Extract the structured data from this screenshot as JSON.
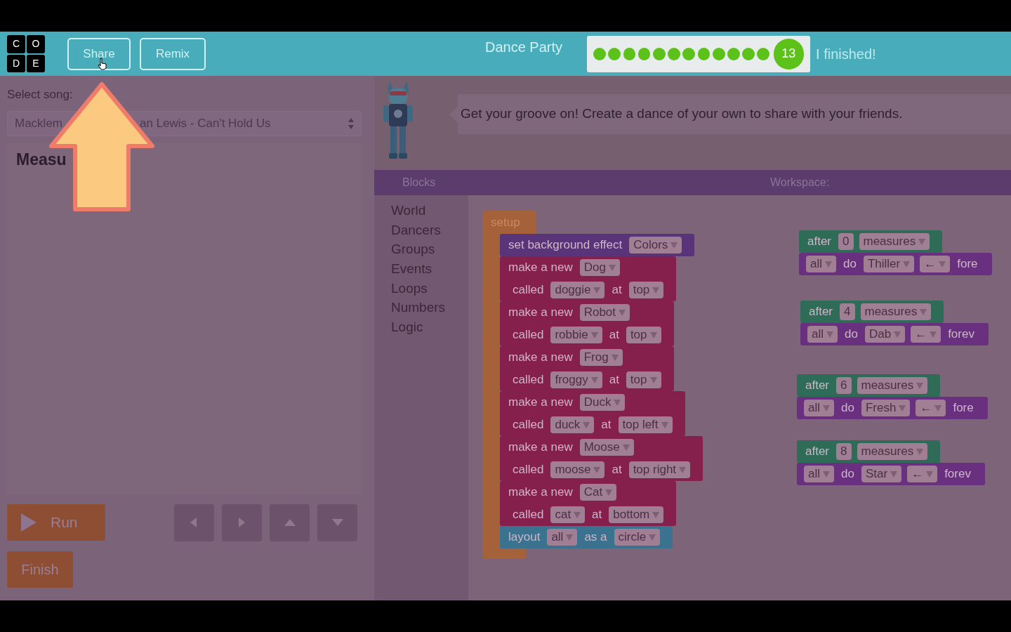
{
  "header": {
    "logo_letters": [
      "C",
      "O",
      "D",
      "E"
    ],
    "buttons": [
      "Share",
      "Remix"
    ],
    "title": "Dance Party",
    "progress": {
      "dots": [
        {
          "completed": true
        },
        {
          "completed": true
        },
        {
          "completed": true
        },
        {
          "completed": true
        },
        {
          "completed": true
        },
        {
          "completed": true
        },
        {
          "completed": true
        },
        {
          "completed": true
        },
        {
          "completed": true
        },
        {
          "completed": true
        },
        {
          "completed": true
        },
        {
          "completed": true
        }
      ],
      "current": "13"
    },
    "finish_link": "I finished!"
  },
  "left_panel": {
    "song_label": "Select song:",
    "song_select_parts": [
      "Macklem",
      "an Lewis - Can't Hold Us"
    ],
    "heading": "Measu",
    "run_button": "Run",
    "arrow_buttons": [
      {
        "kind": "left"
      },
      {
        "kind": "right"
      },
      {
        "kind": "up"
      },
      {
        "kind": "down"
      }
    ],
    "finish_button": "Finish"
  },
  "instructions": "Get your groove on! Create a dance of your own to share with your friends.",
  "blocks_header": "Blocks",
  "workspace_header": "Workspace:",
  "categories": [
    "World",
    "Dancers",
    "Groups",
    "Events",
    "Loops",
    "Numbers",
    "Logic"
  ],
  "workspace": {
    "stacks": [
      {
        "kind": "setup",
        "label": "setup",
        "blocks": [
          {
            "kind": "effect",
            "lines": [
              {
                "parts": [
                  {
                    "kind": "text",
                    "text": "set background effect"
                  },
                  {
                    "kind": "dropdown",
                    "text": "Colors"
                  }
                ]
              }
            ]
          },
          {
            "kind": "sprite",
            "lines": [
              {
                "parts": [
                  {
                    "kind": "text",
                    "text": "make a new"
                  },
                  {
                    "kind": "dropdown",
                    "text": "Dog"
                  }
                ]
              },
              {
                "parts": [
                  {
                    "kind": "text",
                    "text": "called"
                  },
                  {
                    "kind": "dropdown",
                    "text": "doggie"
                  },
                  {
                    "kind": "text",
                    "text": "at"
                  },
                  {
                    "kind": "dropdown",
                    "text": "top"
                  }
                ]
              }
            ]
          },
          {
            "kind": "sprite",
            "lines": [
              {
                "parts": [
                  {
                    "kind": "text",
                    "text": "make a new"
                  },
                  {
                    "kind": "dropdown",
                    "text": "Robot"
                  }
                ]
              },
              {
                "parts": [
                  {
                    "kind": "text",
                    "text": "called"
                  },
                  {
                    "kind": "dropdown",
                    "text": "robbie"
                  },
                  {
                    "kind": "text",
                    "text": "at"
                  },
                  {
                    "kind": "dropdown",
                    "text": "top"
                  }
                ]
              }
            ]
          },
          {
            "kind": "sprite",
            "lines": [
              {
                "parts": [
                  {
                    "kind": "text",
                    "text": "make a new"
                  },
                  {
                    "kind": "dropdown",
                    "text": "Frog"
                  }
                ]
              },
              {
                "parts": [
                  {
                    "kind": "text",
                    "text": "called"
                  },
                  {
                    "kind": "dropdown",
                    "text": "froggy"
                  },
                  {
                    "kind": "text",
                    "text": "at"
                  },
                  {
                    "kind": "dropdown",
                    "text": "top"
                  }
                ]
              }
            ]
          },
          {
            "kind": "sprite",
            "lines": [
              {
                "parts": [
                  {
                    "kind": "text",
                    "text": "make a new"
                  },
                  {
                    "kind": "dropdown",
                    "text": "Duck"
                  }
                ]
              },
              {
                "parts": [
                  {
                    "kind": "text",
                    "text": "called"
                  },
                  {
                    "kind": "dropdown",
                    "text": "duck"
                  },
                  {
                    "kind": "text",
                    "text": "at"
                  },
                  {
                    "kind": "dropdown",
                    "text": "top left"
                  }
                ]
              }
            ]
          },
          {
            "kind": "sprite",
            "lines": [
              {
                "parts": [
                  {
                    "kind": "text",
                    "text": "make a new"
                  },
                  {
                    "kind": "dropdown",
                    "text": "Moose"
                  }
                ]
              },
              {
                "parts": [
                  {
                    "kind": "text",
                    "text": "called"
                  },
                  {
                    "kind": "dropdown",
                    "text": "moose"
                  },
                  {
                    "kind": "text",
                    "text": "at"
                  },
                  {
                    "kind": "dropdown",
                    "text": "top right"
                  }
                ]
              }
            ]
          },
          {
            "kind": "sprite",
            "lines": [
              {
                "parts": [
                  {
                    "kind": "text",
                    "text": "make a new"
                  },
                  {
                    "kind": "dropdown",
                    "text": "Cat"
                  }
                ]
              },
              {
                "parts": [
                  {
                    "kind": "text",
                    "text": "called"
                  },
                  {
                    "kind": "dropdown",
                    "text": "cat"
                  },
                  {
                    "kind": "text",
                    "text": "at"
                  },
                  {
                    "kind": "dropdown",
                    "text": "bottom"
                  }
                ]
              }
            ]
          },
          {
            "kind": "layout",
            "lines": [
              {
                "parts": [
                  {
                    "kind": "text",
                    "text": "layout"
                  },
                  {
                    "kind": "dropdown",
                    "text": "all"
                  },
                  {
                    "kind": "text",
                    "text": "as a"
                  },
                  {
                    "kind": "dropdown",
                    "text": "circle"
                  }
                ]
              }
            ]
          }
        ]
      },
      {
        "kind": "event",
        "blocks": [
          {
            "kind": "event",
            "lines": [
              {
                "parts": [
                  {
                    "kind": "text",
                    "text": "after"
                  },
                  {
                    "kind": "number",
                    "text": "0"
                  },
                  {
                    "kind": "dropdown",
                    "text": "measures"
                  }
                ]
              }
            ]
          },
          {
            "kind": "action",
            "lines": [
              {
                "parts": [
                  {
                    "kind": "dropdown",
                    "text": "all"
                  },
                  {
                    "kind": "text",
                    "text": "do"
                  },
                  {
                    "kind": "dropdown",
                    "text": "Thiller"
                  },
                  {
                    "kind": "dropdown",
                    "text": "←"
                  },
                  {
                    "kind": "text",
                    "text": "fore"
                  }
                ]
              }
            ]
          }
        ]
      },
      {
        "kind": "event",
        "blocks": [
          {
            "kind": "event",
            "lines": [
              {
                "parts": [
                  {
                    "kind": "text",
                    "text": "after"
                  },
                  {
                    "kind": "number",
                    "text": "4"
                  },
                  {
                    "kind": "dropdown",
                    "text": "measures"
                  }
                ]
              }
            ]
          },
          {
            "kind": "action",
            "lines": [
              {
                "parts": [
                  {
                    "kind": "dropdown",
                    "text": "all"
                  },
                  {
                    "kind": "text",
                    "text": "do"
                  },
                  {
                    "kind": "dropdown",
                    "text": "Dab"
                  },
                  {
                    "kind": "dropdown",
                    "text": "←"
                  },
                  {
                    "kind": "text",
                    "text": "forev"
                  }
                ]
              }
            ]
          }
        ]
      },
      {
        "kind": "event",
        "blocks": [
          {
            "kind": "event",
            "lines": [
              {
                "parts": [
                  {
                    "kind": "text",
                    "text": "after"
                  },
                  {
                    "kind": "number",
                    "text": "6"
                  },
                  {
                    "kind": "dropdown",
                    "text": "measures"
                  }
                ]
              }
            ]
          },
          {
            "kind": "action",
            "lines": [
              {
                "parts": [
                  {
                    "kind": "dropdown",
                    "text": "all"
                  },
                  {
                    "kind": "text",
                    "text": "do"
                  },
                  {
                    "kind": "dropdown",
                    "text": "Fresh"
                  },
                  {
                    "kind": "dropdown",
                    "text": "←"
                  },
                  {
                    "kind": "text",
                    "text": "fore"
                  }
                ]
              }
            ]
          }
        ]
      },
      {
        "kind": "event",
        "blocks": [
          {
            "kind": "event",
            "lines": [
              {
                "parts": [
                  {
                    "kind": "text",
                    "text": "after"
                  },
                  {
                    "kind": "number",
                    "text": "8"
                  },
                  {
                    "kind": "dropdown",
                    "text": "measures"
                  }
                ]
              }
            ]
          },
          {
            "kind": "action",
            "lines": [
              {
                "parts": [
                  {
                    "kind": "dropdown",
                    "text": "all"
                  },
                  {
                    "kind": "text",
                    "text": "do"
                  },
                  {
                    "kind": "dropdown",
                    "text": "Star"
                  },
                  {
                    "kind": "dropdown",
                    "text": "←"
                  },
                  {
                    "kind": "text",
                    "text": "forev"
                  }
                ]
              }
            ]
          }
        ]
      }
    ]
  }
}
